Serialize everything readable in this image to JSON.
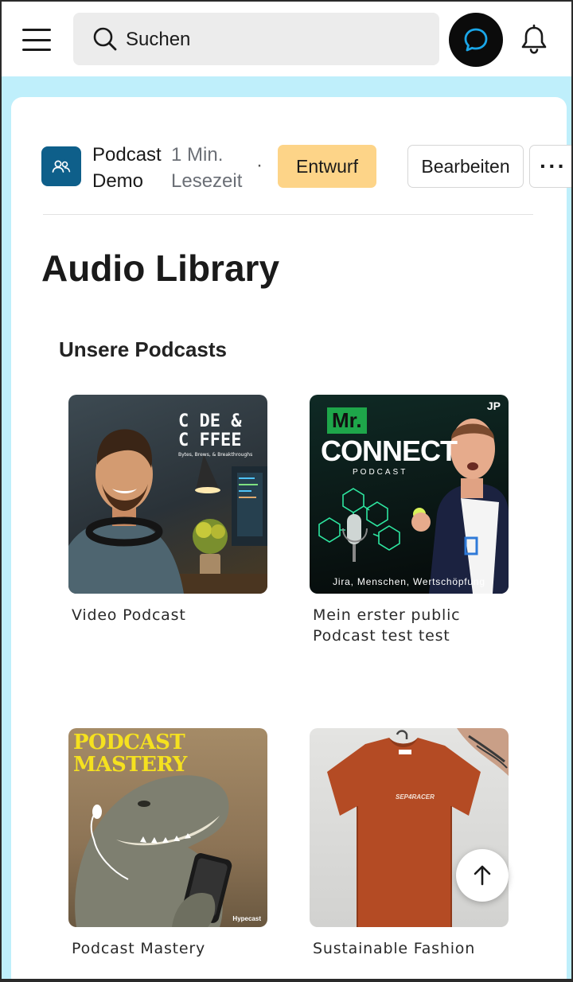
{
  "header": {
    "menu_icon": "hamburger-menu-icon",
    "search_placeholder": "Suchen",
    "chat_icon": "chat-bubble-icon",
    "notifications_icon": "bell-icon"
  },
  "post_meta": {
    "author_icon": "users-icon",
    "author": "Podcast Demo",
    "read_time": "1 Min. Lesezeit",
    "separator": "·",
    "status_badge": "Entwurf",
    "edit_label": "Bearbeiten",
    "more_label": "···"
  },
  "page": {
    "title": "Audio Library",
    "section_title": "Unsere Podcasts"
  },
  "podcasts": [
    {
      "label": "Video Podcast",
      "cover_title_line1": "C DE &",
      "cover_title_line2": "C FFEE",
      "cover_subtitle": "Bytes, Brews, & Breakthroughs"
    },
    {
      "label": "Mein erster public Podcast test test",
      "cover_badge": "Mr.",
      "cover_title": "CONNECT",
      "cover_subtitle": "PODCAST",
      "cover_footer": "Jira, Menschen, Wertschöpfung",
      "cover_logo": "JP"
    },
    {
      "label": "Podcast Mastery",
      "cover_title_line1": "PODCAST",
      "cover_title_line2": "MASTERY",
      "cover_brand": "Hypecast"
    },
    {
      "label": "Sustainable Fashion",
      "cover_shirt_text": "SEP4RACER"
    }
  ],
  "scroll_top_icon": "arrow-up-icon",
  "colors": {
    "backdrop": "#bfeffb",
    "avatar": "#0e5f8a",
    "draft_badge": "#fdd488",
    "chat_ring": "#1aa6e8"
  }
}
